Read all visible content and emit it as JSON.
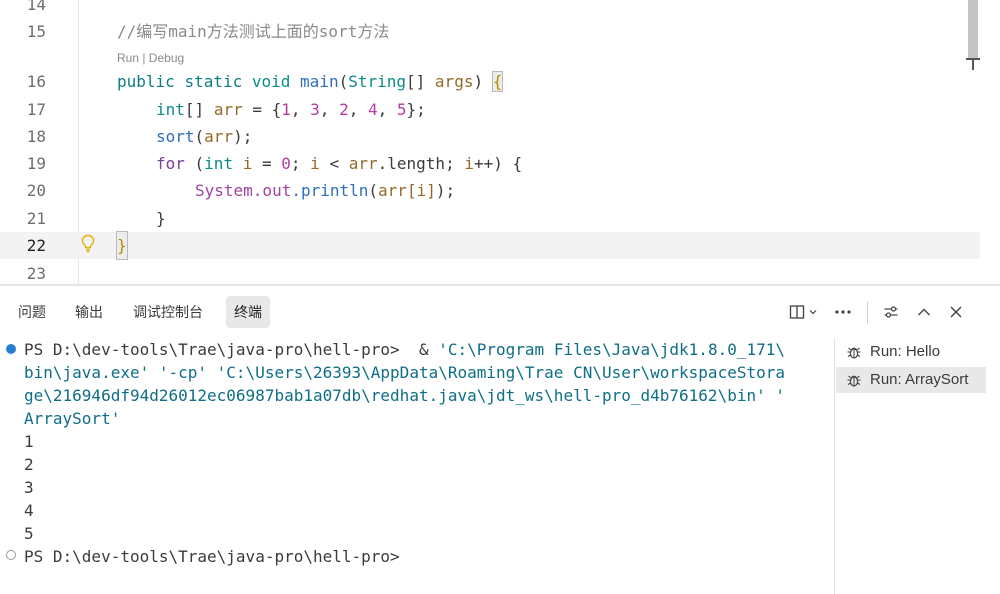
{
  "editor": {
    "lines": [
      {
        "no": "14"
      },
      {
        "no": "15",
        "comment": "//编写main方法测试上面的sort方法"
      },
      {
        "no": "16",
        "public": "public",
        "static": "static",
        "void": "void",
        "main": "main",
        "p1": "(",
        "String": "String",
        "arr_br": "[]",
        "args": "args",
        "p2": ")",
        "brace": "{"
      },
      {
        "no": "17",
        "int": "int",
        "br": "[]",
        "arr": "arr",
        "eq": " = {",
        "n1": "1",
        "n2": "3",
        "n3": "2",
        "n4": "4",
        "n5": "5",
        "end": "};"
      },
      {
        "no": "18",
        "sort": "sort",
        "p1": "(",
        "arr": "arr",
        "end": ");"
      },
      {
        "no": "19",
        "for": "for",
        "p1": " (",
        "int": "int",
        "i": "i",
        "eq": " = ",
        "zero": "0",
        "semi": "; ",
        "i2": "i",
        "lt": " < ",
        "arr": "arr",
        "length": ".length",
        "semi2": "; ",
        "i3": "i",
        "inc": "++) {"
      },
      {
        "no": "20",
        "System": "System",
        "out": ".out",
        "println": ".println",
        "p1": "(",
        "arr": "arr",
        "idx_open": "[",
        "i": "i",
        "idx_close": "]",
        "end": ");"
      },
      {
        "no": "21",
        "brace": "}"
      },
      {
        "no": "22",
        "brace": "}"
      },
      {
        "no": "23"
      }
    ],
    "codelens": "Run | Debug"
  },
  "panel": {
    "tabs": [
      "问题",
      "输出",
      "调试控制台",
      "终端"
    ],
    "active_tab": "终端"
  },
  "terminal": {
    "lines": [
      "PS D:\\dev-tools\\Trae\\java-pro\\hell-pro>  & ",
      "'C:\\Program Files\\Java\\jdk1.8.0_171\\",
      "bin\\java.exe' '-cp' 'C:\\Users\\26393\\AppData\\Roaming\\Trae CN\\User\\workspaceStora",
      "ge\\216946df94d26012ec06987bab1a07db\\redhat.java\\jdt_ws\\hell-pro_d4b76162\\bin' '",
      "ArraySort'",
      "1",
      "2",
      "3",
      "4",
      "5",
      "PS D:\\dev-tools\\Trae\\java-pro\\hell-pro>"
    ],
    "sessions": [
      "Run: Hello",
      "Run: ArraySort"
    ],
    "selected_session": "Run: ArraySort"
  },
  "colors": {
    "accent": "#2a7ed0",
    "lightbulb": "#e2b007"
  }
}
